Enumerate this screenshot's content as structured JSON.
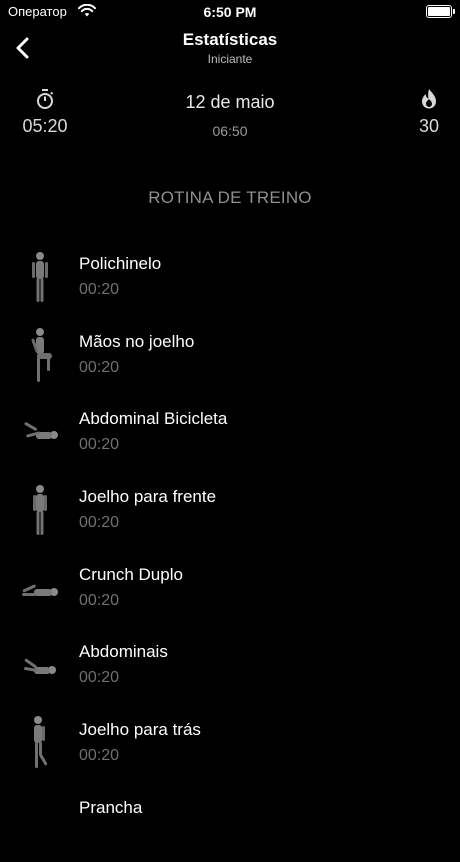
{
  "status": {
    "carrier": "Оператор",
    "time": "6:50 PM"
  },
  "header": {
    "title": "Estatísticas",
    "subtitle": "Iniciante"
  },
  "stats": {
    "duration": "05:20",
    "date": "12 de maio",
    "date_time": "06:50",
    "calories": "30"
  },
  "section_title": "ROTINA DE TREINO",
  "exercises": [
    {
      "name": "Polichinelo",
      "duration": "00:20",
      "icon": "standing-figure-icon"
    },
    {
      "name": "Mãos no joelho",
      "duration": "00:20",
      "icon": "knee-raise-figure-icon"
    },
    {
      "name": "Abdominal Bicicleta",
      "duration": "00:20",
      "icon": "lying-figure-icon"
    },
    {
      "name": "Joelho para frente",
      "duration": "00:20",
      "icon": "standing-figure-icon"
    },
    {
      "name": "Crunch Duplo",
      "duration": "00:20",
      "icon": "lying-figure-icon"
    },
    {
      "name": "Abdominais",
      "duration": "00:20",
      "icon": "lying-figure-icon"
    },
    {
      "name": "Joelho para trás",
      "duration": "00:20",
      "icon": "standing-figure-icon"
    },
    {
      "name": "Prancha",
      "duration": "",
      "icon": ""
    }
  ]
}
